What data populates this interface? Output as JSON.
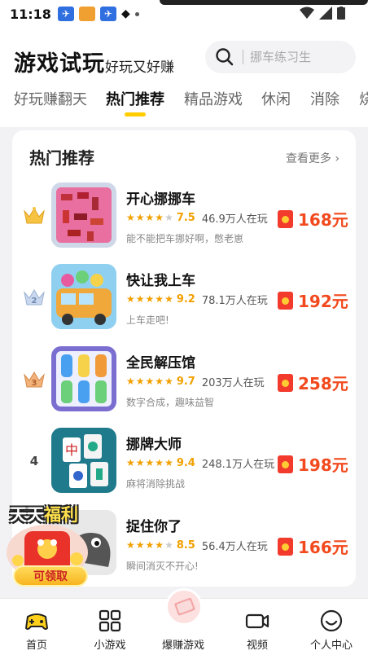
{
  "status_bar": {
    "time": "11:18"
  },
  "header": {
    "title": "游戏试玩",
    "subtitle": "好玩又好赚",
    "search_placeholder": "挪车练习生"
  },
  "tabs": [
    {
      "label": "好玩赚翻天"
    },
    {
      "label": "热门推荐"
    },
    {
      "label": "精品游戏"
    },
    {
      "label": "休闲"
    },
    {
      "label": "消除"
    },
    {
      "label": "烧"
    }
  ],
  "card": {
    "title": "热门推荐",
    "more": "查看更多 ›"
  },
  "games": [
    {
      "rank": "",
      "rank_icon": "gold-crown-icon",
      "name": "开心挪挪车",
      "stars": 3.5,
      "rating": "7.5",
      "players": "46.9万人在玩",
      "desc": "能不能把车挪好啊，憋老崽",
      "reward": "168元"
    },
    {
      "rank": "",
      "rank_icon": "silver-crown-icon",
      "name": "快让我上车",
      "stars": 4.5,
      "rating": "9.2",
      "players": "78.1万人在玩",
      "desc": "上车走吧!",
      "reward": "192元"
    },
    {
      "rank": "",
      "rank_icon": "bronze-crown-icon",
      "name": "全民解压馆",
      "stars": 5,
      "rating": "9.7",
      "players": "203万人在玩",
      "desc": "数字合成，趣味益智",
      "reward": "258元"
    },
    {
      "rank": "4",
      "rank_icon": "",
      "name": "挪牌大师",
      "stars": 4.5,
      "rating": "9.4",
      "players": "248.1万人在玩",
      "desc": "麻将消除挑战",
      "reward": "198元"
    },
    {
      "rank": "",
      "rank_icon": "",
      "name": "捉住你了",
      "stars": 4,
      "rating": "8.5",
      "players": "56.4万人在玩",
      "desc": "瞬间消灭不开心!",
      "reward": "166元"
    }
  ],
  "promo": {
    "title_a": "天天",
    "title_b": "福利",
    "button": "可领取"
  },
  "nav": [
    {
      "label": "首页",
      "icon": "gamepad-icon"
    },
    {
      "label": "小游戏",
      "icon": "grid-icon"
    },
    {
      "label": "爆赚游戏",
      "icon": "money-icon"
    },
    {
      "label": "视频",
      "icon": "video-icon"
    },
    {
      "label": "个人中心",
      "icon": "smiley-icon"
    }
  ],
  "colors": {
    "accent": "#ffcc00",
    "reward": "#f24a1e",
    "rating": "#f2a000"
  }
}
